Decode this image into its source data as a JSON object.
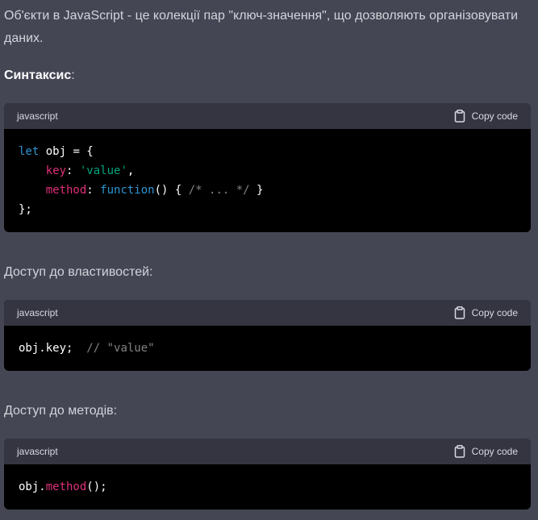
{
  "intro_text": "Об'єкти в JavaScript - це колекції пар \"ключ-значення\", що дозволяють організовувати даних.",
  "sections": [
    {
      "heading_strong": "Синтаксис",
      "heading_rest": ":",
      "code": {
        "language": "javascript",
        "copy_label": "Copy code",
        "lines": [
          [
            {
              "t": "kw",
              "v": "let"
            },
            {
              "t": "plain",
              "v": " obj = {"
            }
          ],
          [
            {
              "t": "plain",
              "v": "    "
            },
            {
              "t": "attr",
              "v": "key"
            },
            {
              "t": "plain",
              "v": ": "
            },
            {
              "t": "str",
              "v": "'value'"
            },
            {
              "t": "plain",
              "v": ","
            }
          ],
          [
            {
              "t": "plain",
              "v": "    "
            },
            {
              "t": "attr",
              "v": "method"
            },
            {
              "t": "plain",
              "v": ": "
            },
            {
              "t": "kw",
              "v": "function"
            },
            {
              "t": "plain",
              "v": "() { "
            },
            {
              "t": "cmt",
              "v": "/* ... */"
            },
            {
              "t": "plain",
              "v": " }"
            }
          ],
          [
            {
              "t": "plain",
              "v": "};"
            }
          ]
        ]
      }
    },
    {
      "heading_strong": "",
      "heading_rest": "Доступ до властивостей:",
      "code": {
        "language": "javascript",
        "copy_label": "Copy code",
        "lines": [
          [
            {
              "t": "plain",
              "v": "obj.key;  "
            },
            {
              "t": "cmt",
              "v": "// \"value\""
            }
          ]
        ]
      }
    },
    {
      "heading_strong": "",
      "heading_rest": "Доступ до методів:",
      "code": {
        "language": "javascript",
        "copy_label": "Copy code",
        "lines": [
          [
            {
              "t": "plain",
              "v": "obj."
            },
            {
              "t": "attr",
              "v": "method"
            },
            {
              "t": "plain",
              "v": "();"
            }
          ]
        ]
      }
    }
  ],
  "colors": {
    "background": "#444654",
    "code_header_bg": "#343541",
    "code_bg": "#000000",
    "keyword": "#2e95d3",
    "string": "#00a67d",
    "attribute": "#df3079"
  },
  "icons": {
    "copy": "clipboard-icon"
  }
}
